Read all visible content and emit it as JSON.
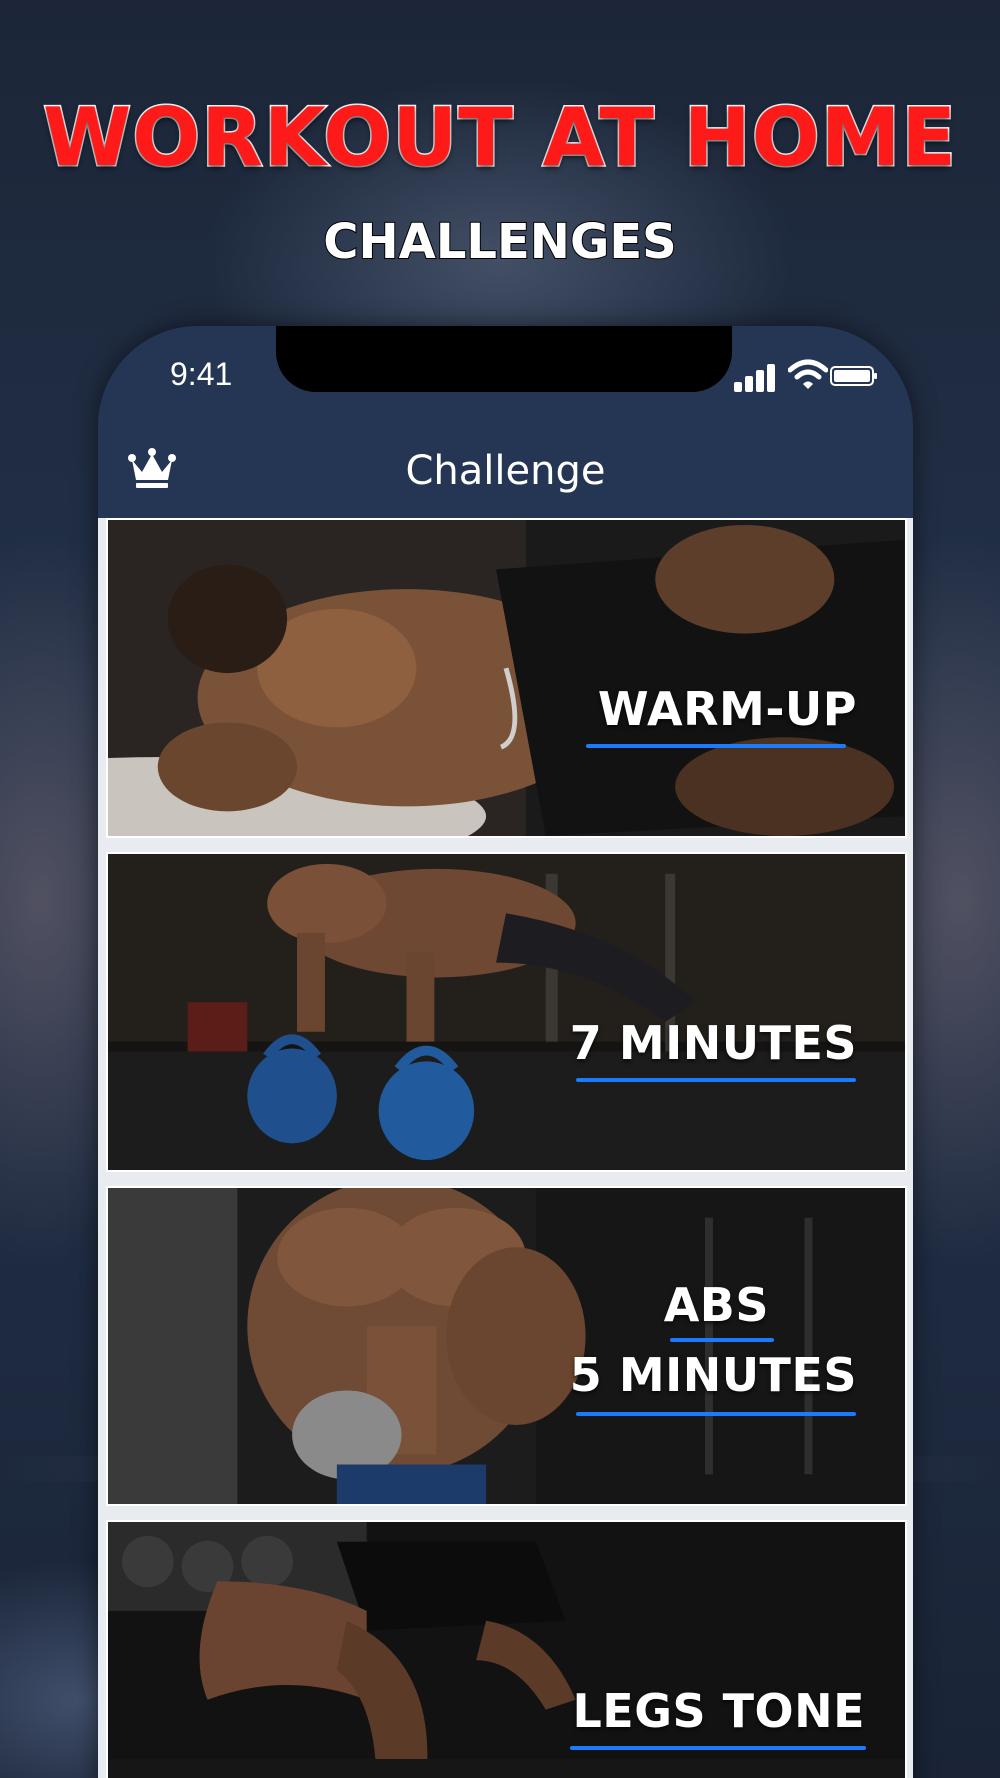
{
  "promo": {
    "headline": "WORKOUT AT HOME",
    "subheadline": "CHALLENGES"
  },
  "status_bar": {
    "time": "9:41"
  },
  "header": {
    "title": "Challenge",
    "premium_icon": "crown-icon"
  },
  "challenges": [
    {
      "lines": [
        "WARM-UP"
      ],
      "theme": "lying-abs"
    },
    {
      "lines": [
        "7 MINUTES"
      ],
      "theme": "kettlebell-pushup"
    },
    {
      "lines": [
        "ABS",
        "5 MINUTES"
      ],
      "theme": "dumbbell-curl"
    },
    {
      "lines": [
        "LEGS TONE"
      ],
      "theme": "leg-lunge"
    }
  ],
  "colors": {
    "headline": "#ff1a1a",
    "header_bg": "#243654",
    "accent_underline": "#1a7bff"
  }
}
